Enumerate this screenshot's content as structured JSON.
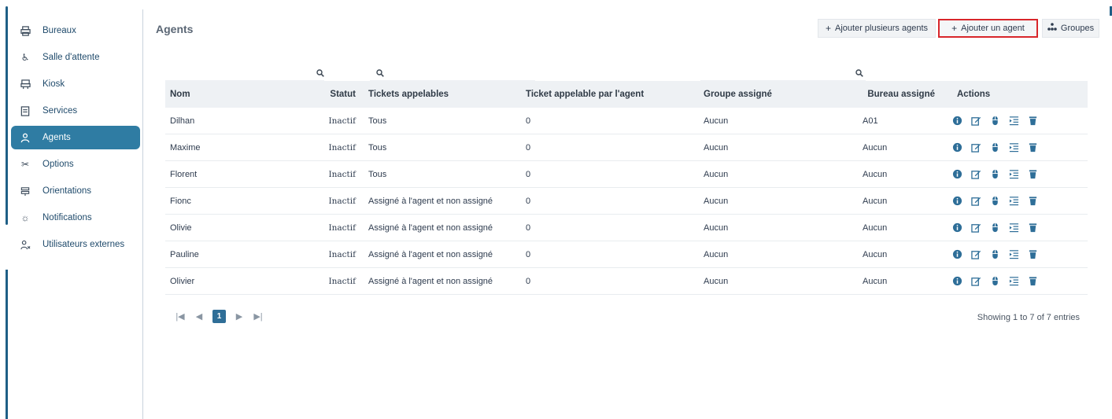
{
  "sidebar": {
    "items": [
      {
        "label": "Bureaux",
        "icon": "printer-icon"
      },
      {
        "label": "Salle d'attente",
        "icon": "wheelchair-icon"
      },
      {
        "label": "Kiosk",
        "icon": "kiosk-icon"
      },
      {
        "label": "Services",
        "icon": "document-icon"
      },
      {
        "label": "Agents",
        "icon": "user-icon"
      },
      {
        "label": "Options",
        "icon": "tools-icon"
      },
      {
        "label": "Orientations",
        "icon": "signpost-icon"
      },
      {
        "label": "Notifications",
        "icon": "bulb-icon"
      },
      {
        "label": "Utilisateurs externes",
        "icon": "external-user-icon"
      }
    ],
    "active": "Agents"
  },
  "header": {
    "title": "Agents",
    "add_multiple_label": "Ajouter plusieurs agents",
    "add_one_label": "Ajouter un agent",
    "groups_label": "Groupes"
  },
  "table": {
    "columns": [
      "Nom",
      "Statut",
      "Tickets appelables",
      "Ticket appelable par l'agent",
      "Groupe assigné",
      "Bureau assigné",
      "Actions"
    ],
    "rows": [
      {
        "nom": "Dilhan",
        "statut": "Inactif",
        "tickets": "Tous",
        "tap": "0",
        "groupe": "Aucun",
        "bureau": "A01"
      },
      {
        "nom": "Maxime",
        "statut": "Inactif",
        "tickets": "Tous",
        "tap": "0",
        "groupe": "Aucun",
        "bureau": "Aucun"
      },
      {
        "nom": "Florent",
        "statut": "Inactif",
        "tickets": "Tous",
        "tap": "0",
        "groupe": "Aucun",
        "bureau": "Aucun"
      },
      {
        "nom": "Fionc",
        "statut": "Inactif",
        "tickets": "Assigné à l'agent et non assigné",
        "tap": "0",
        "groupe": "Aucun",
        "bureau": "Aucun"
      },
      {
        "nom": "Olivie",
        "statut": "Inactif",
        "tickets": "Assigné à l'agent et non assigné",
        "tap": "0",
        "groupe": "Aucun",
        "bureau": "Aucun"
      },
      {
        "nom": "Pauline",
        "statut": "Inactif",
        "tickets": "Assigné à l'agent et non assigné",
        "tap": "0",
        "groupe": "Aucun",
        "bureau": "Aucun"
      },
      {
        "nom": "Olivier",
        "statut": "Inactif",
        "tickets": "Assigné à l'agent et non assigné",
        "tap": "0",
        "groupe": "Aucun",
        "bureau": "Aucun"
      }
    ],
    "row_actions": [
      "info-icon",
      "edit-icon",
      "mouse-icon",
      "list-indent-icon",
      "trash-icon"
    ]
  },
  "pagination": {
    "current_page": "1",
    "showing_text": "Showing 1 to 7 of 7 entries"
  },
  "colors": {
    "accent": "#2f7ca3",
    "highlight_border": "#d8262b",
    "action_icon": "#2e6e98"
  }
}
